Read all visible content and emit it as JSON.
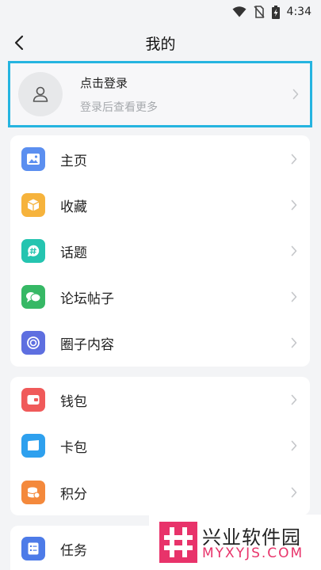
{
  "status_bar": {
    "time": "4:34",
    "icons": [
      "wifi-icon",
      "no-sim-icon",
      "battery-charging-icon"
    ]
  },
  "header": {
    "title": "我的",
    "back_icon": "chevron-left-icon"
  },
  "login": {
    "title": "点击登录",
    "subtitle": "登录后查看更多",
    "avatar_icon": "user-icon",
    "highlight_color": "#25b4e0"
  },
  "groups": [
    {
      "items": [
        {
          "label": "主页",
          "icon": "image-icon",
          "color": "#5b8ff0"
        },
        {
          "label": "收藏",
          "icon": "box-icon",
          "color": "#f6b33c"
        },
        {
          "label": "话题",
          "icon": "hashtag-icon",
          "color": "#25c4b0"
        },
        {
          "label": "论坛帖子",
          "icon": "chat-bubbles-icon",
          "color": "#36b865"
        },
        {
          "label": "圈子内容",
          "icon": "circle-icon",
          "color": "#5e6fe0"
        }
      ]
    },
    {
      "items": [
        {
          "label": "钱包",
          "icon": "wallet-icon",
          "color": "#f05a5a"
        },
        {
          "label": "卡包",
          "icon": "card-icon",
          "color": "#2ea0ee"
        },
        {
          "label": "积分",
          "icon": "coins-icon",
          "color": "#f4893c"
        }
      ]
    },
    {
      "items": [
        {
          "label": "任务",
          "icon": "task-list-icon",
          "color": "#4d7be8"
        }
      ]
    }
  ],
  "watermark": {
    "brand": "兴业软件园",
    "url": "MYXYJS.COM",
    "brand_color": "#e8336a"
  }
}
